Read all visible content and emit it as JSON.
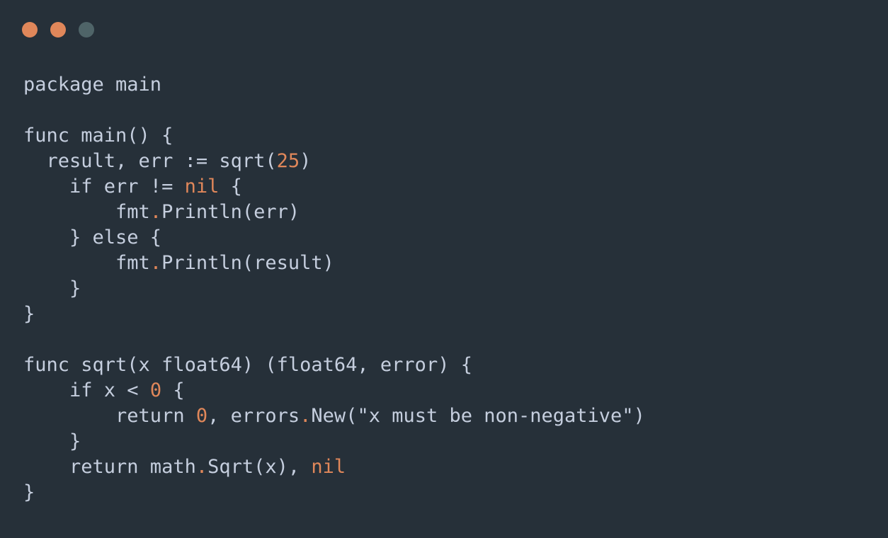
{
  "window": {
    "controls": [
      {
        "name": "close-dot",
        "color": "#e0875a"
      },
      {
        "name": "minimize-dot",
        "color": "#e0875a"
      },
      {
        "name": "maximize-dot",
        "color": "#4f6468"
      }
    ]
  },
  "colors": {
    "background": "#263039",
    "text": "#c5cede",
    "accent": "#e0875a"
  },
  "code": {
    "language": "go",
    "lines": [
      [
        {
          "t": "package main"
        }
      ],
      [],
      [
        {
          "t": "func main() {"
        }
      ],
      [
        {
          "t": "  result, err := sqrt("
        },
        {
          "t": "25",
          "a": true
        },
        {
          "t": ")"
        }
      ],
      [
        {
          "t": "    if err != "
        },
        {
          "t": "nil",
          "a": true
        },
        {
          "t": " {"
        }
      ],
      [
        {
          "t": "        fmt"
        },
        {
          "t": ".",
          "a": true
        },
        {
          "t": "Println(err)"
        }
      ],
      [
        {
          "t": "    } else {"
        }
      ],
      [
        {
          "t": "        fmt"
        },
        {
          "t": ".",
          "a": true
        },
        {
          "t": "Println(result)"
        }
      ],
      [
        {
          "t": "    }"
        }
      ],
      [
        {
          "t": "}"
        }
      ],
      [],
      [
        {
          "t": "func sqrt(x float64) (float64, error) {"
        }
      ],
      [
        {
          "t": "    if x < "
        },
        {
          "t": "0",
          "a": true
        },
        {
          "t": " {"
        }
      ],
      [
        {
          "t": "        return "
        },
        {
          "t": "0",
          "a": true
        },
        {
          "t": ", errors"
        },
        {
          "t": ".",
          "a": true
        },
        {
          "t": "New(\"x must be non-negative\")"
        }
      ],
      [
        {
          "t": "    }"
        }
      ],
      [
        {
          "t": "    return math"
        },
        {
          "t": ".",
          "a": true
        },
        {
          "t": "Sqrt(x), "
        },
        {
          "t": "nil",
          "a": true
        }
      ],
      [
        {
          "t": "}"
        }
      ]
    ]
  }
}
